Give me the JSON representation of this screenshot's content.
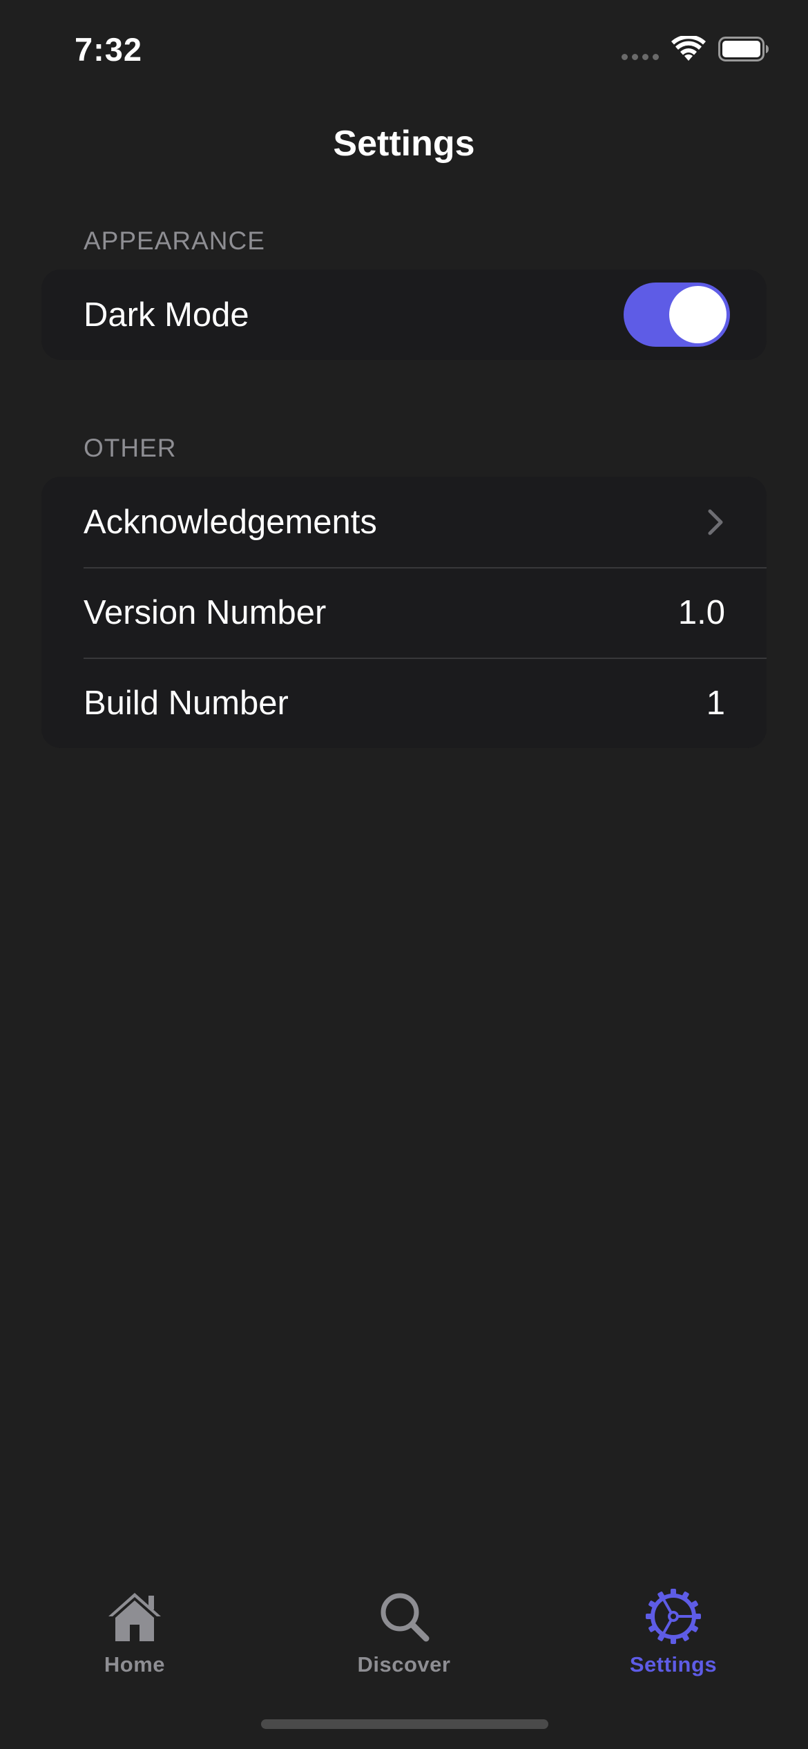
{
  "status_bar": {
    "time": "7:32"
  },
  "nav": {
    "title": "Settings"
  },
  "appearance": {
    "header": "APPEARANCE",
    "dark_mode_label": "Dark Mode",
    "dark_mode_on": true
  },
  "other": {
    "header": "OTHER",
    "rows": [
      {
        "label": "Acknowledgements",
        "value": ""
      },
      {
        "label": "Version Number",
        "value": "1.0"
      },
      {
        "label": "Build Number",
        "value": "1"
      }
    ]
  },
  "tab_bar": {
    "tabs": [
      {
        "label": "Home",
        "icon": "house-icon",
        "active": false
      },
      {
        "label": "Discover",
        "icon": "magnifier-icon",
        "active": false
      },
      {
        "label": "Settings",
        "icon": "gear-icon",
        "active": true
      }
    ]
  },
  "colors": {
    "background": "#1f1f1f",
    "group_background": "#1b1b1d",
    "accent": "#5e5ce6",
    "secondary_text": "#8e8e93",
    "inactive_tab": "#8e8e93"
  }
}
